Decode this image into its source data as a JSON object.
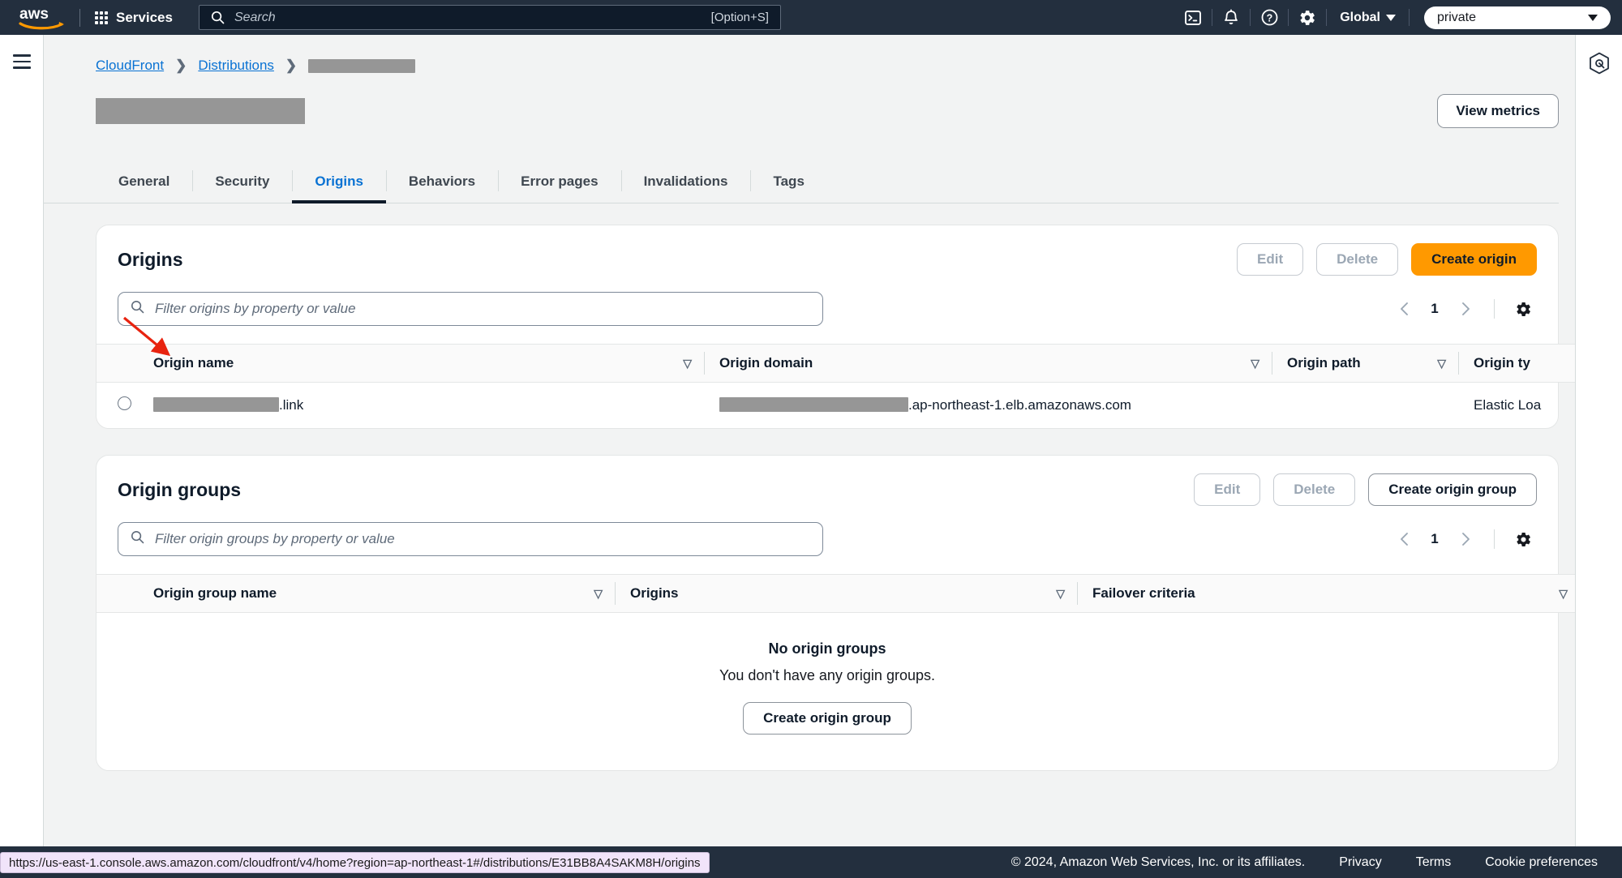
{
  "topnav": {
    "logo": "aws-logo",
    "services_label": "Services",
    "search_placeholder": "Search",
    "search_value": "",
    "search_shortcut": "[Option+S]",
    "icons": [
      "cloudshell-icon",
      "notifications-bell-icon",
      "help-question-icon",
      "settings-gear-icon"
    ],
    "region_label": "Global",
    "account_value": "private"
  },
  "breadcrumb": {
    "items": [
      {
        "label": "CloudFront",
        "type": "link"
      },
      {
        "label": "Distributions",
        "type": "link"
      },
      {
        "label": "",
        "type": "redacted"
      }
    ],
    "separator": "›"
  },
  "page": {
    "title_redacted": true,
    "view_metrics_label": "View metrics"
  },
  "tabs": [
    {
      "label": "General",
      "active": false
    },
    {
      "label": "Security",
      "active": false
    },
    {
      "label": "Origins",
      "active": true
    },
    {
      "label": "Behaviors",
      "active": false
    },
    {
      "label": "Error pages",
      "active": false
    },
    {
      "label": "Invalidations",
      "active": false
    },
    {
      "label": "Tags",
      "active": false
    }
  ],
  "origins_panel": {
    "title": "Origins",
    "edit_label": "Edit",
    "delete_label": "Delete",
    "create_label": "Create origin",
    "filter_placeholder": "Filter origins by property or value",
    "filter_value": "",
    "page_number": "1",
    "prev_icon": "chevron-left-icon",
    "next_icon": "chevron-right-icon",
    "settings_icon": "gear-icon",
    "columns": [
      "Origin name",
      "Origin domain",
      "Origin path",
      "Origin ty"
    ],
    "rows": [
      {
        "selected": false,
        "origin_name_redacted": true,
        "origin_name_suffix": ".link",
        "origin_domain_redacted": true,
        "origin_domain_suffix": ".ap-northeast-1.elb.amazonaws.com",
        "origin_path": "",
        "origin_type": "Elastic Loa"
      }
    ]
  },
  "origin_groups_panel": {
    "title": "Origin groups",
    "edit_label": "Edit",
    "delete_label": "Delete",
    "create_label": "Create origin group",
    "filter_placeholder": "Filter origin groups by property or value",
    "filter_value": "",
    "page_number": "1",
    "columns": [
      "Origin group name",
      "Origins",
      "Failover criteria"
    ],
    "empty_title": "No origin groups",
    "empty_subtitle": "You don't have any origin groups.",
    "empty_button": "Create origin group"
  },
  "footer": {
    "copyright": "© 2024, Amazon Web Services, Inc. or its affiliates.",
    "links": [
      "Privacy",
      "Terms",
      "Cookie preferences"
    ]
  },
  "status_bar": {
    "url": "https://us-east-1.console.aws.amazon.com/cloudfront/v4/home?region=ap-northeast-1#/distributions/E31BB8A4SAKM8H/origins"
  },
  "annotation": {
    "arrow_color": "#e8230f"
  },
  "colors": {
    "nav_bg": "#232f3e",
    "accent_orange": "#ff9900",
    "link_blue": "#0972d3",
    "page_bg": "#f2f3f3",
    "redact_gray": "#969696"
  }
}
